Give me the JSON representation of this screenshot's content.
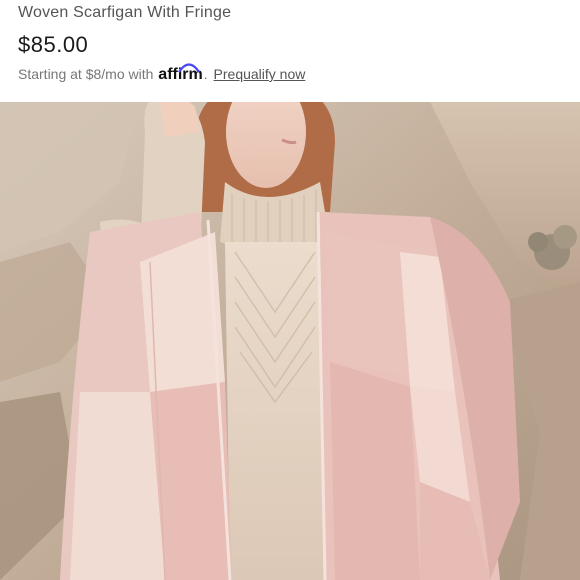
{
  "product": {
    "title": "Woven Scarfigan With Fringe",
    "price": "$85.00",
    "financing_prefix": "Starting at $8/mo with",
    "affirm_brand": "affirm",
    "prequalify_label": "Prequalify now"
  },
  "photo": {
    "subject": "model-wearing-pink-scarfigan"
  },
  "colors": {
    "text_primary": "#1a1a1a",
    "text_secondary": "#777777",
    "blush_pink": "#e8c2bd",
    "light_pink": "#f1ddd5",
    "cream": "#e7d8ca"
  }
}
